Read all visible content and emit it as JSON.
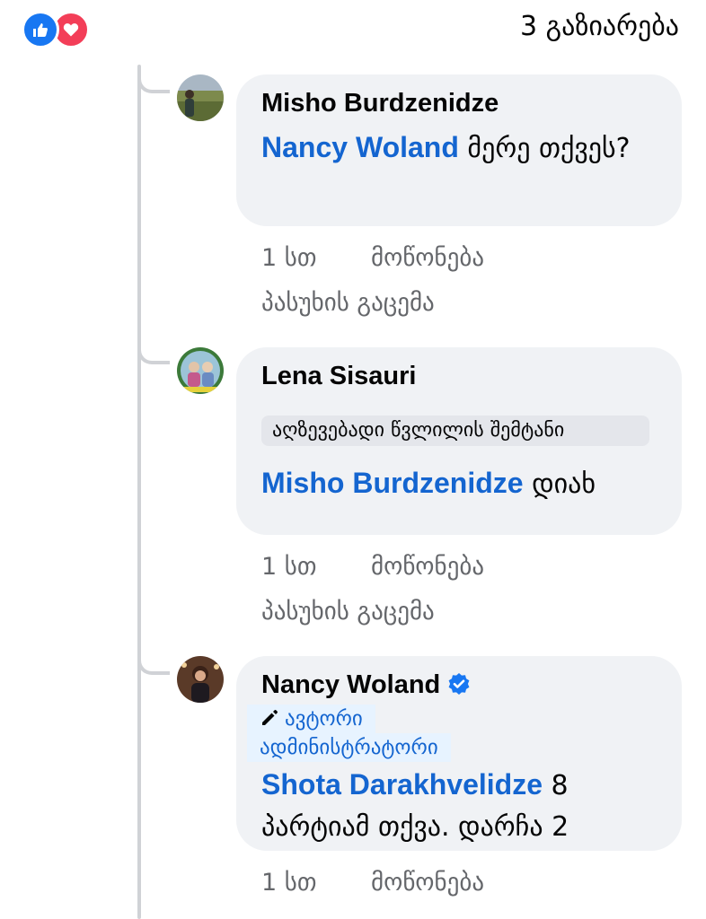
{
  "header": {
    "reactions": [
      "like-icon",
      "love-icon"
    ],
    "shares_label": "3 გაზიარება"
  },
  "comments": [
    {
      "author": "Misho Burdzenidze",
      "mention": "Nancy Woland",
      "text": " მერე თქვეს?",
      "time": "1 სთ",
      "like_label": "მოწონება",
      "reply_label": "პასუხის გაცემა"
    },
    {
      "author": "Lena Sisauri",
      "attachment_text": "აღზევებადი წვლილის შემტანი",
      "mention": "Misho Burdzenidze",
      "text": " დიახ",
      "time": "1 სთ",
      "like_label": "მოწონება",
      "reply_label": "პასუხის გაცემა"
    },
    {
      "author": "Nancy Woland",
      "badge_author": "ავტორი",
      "badge_admin": "ადმინისტრატორი",
      "mention": "Shota Darakhvelidze",
      "text": " 8 პარტიამ თქვა. დარჩა 2",
      "time": "1 სთ",
      "like_label": "მოწონება"
    }
  ],
  "colors": {
    "mention": "#1465d0",
    "bubble": "#f0f2f5",
    "meta": "#65676b",
    "like": "#1877f2",
    "love": "#f33e58"
  }
}
